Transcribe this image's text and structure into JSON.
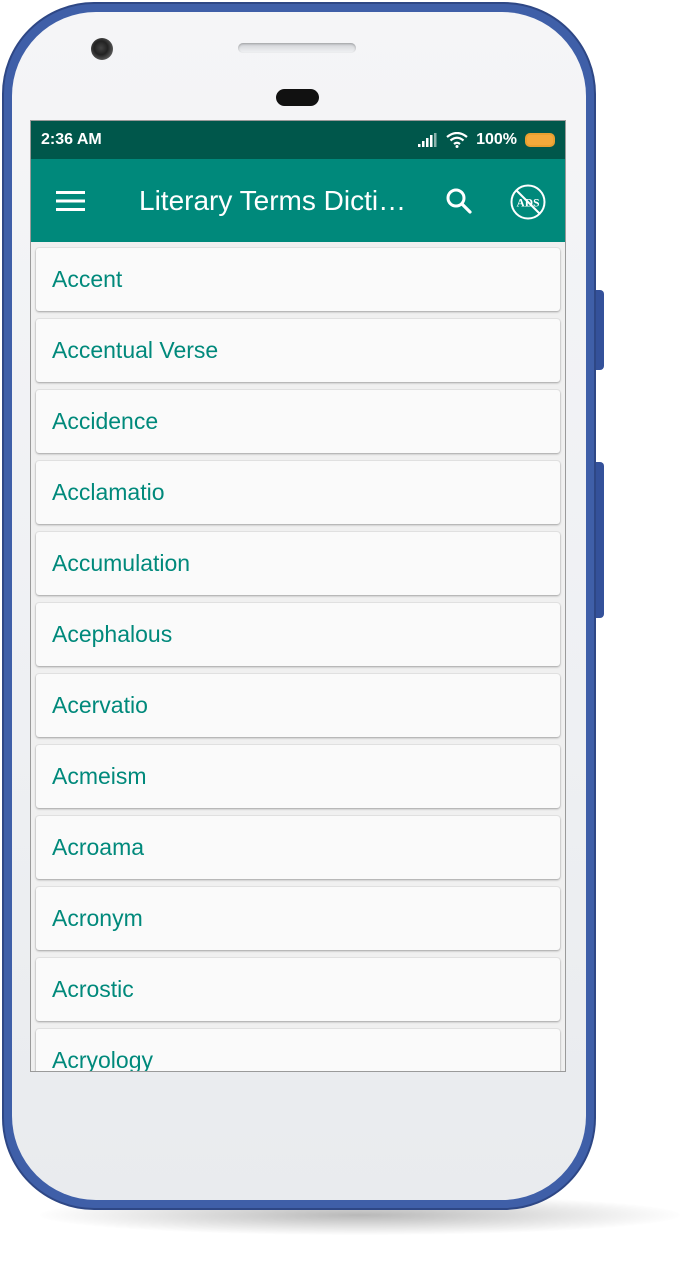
{
  "status_bar": {
    "time": "2:36 AM",
    "battery": "100%"
  },
  "app_bar": {
    "title": "Literary Terms Dictionary",
    "menu_icon": "hamburger-menu-icon",
    "search_icon": "search-icon",
    "ads_icon": "no-ads-icon",
    "ads_label": "ADS"
  },
  "terms": [
    "Accent",
    "Accentual Verse",
    "Accidence",
    "Acclamatio",
    "Accumulation",
    "Acephalous",
    "Acervatio",
    "Acmeism",
    "Acroama",
    "Acronym",
    "Acrostic",
    "Acryology"
  ],
  "colors": {
    "status_bar": "#00574b",
    "app_bar": "#00897b",
    "term_text": "#00897b",
    "phone_frame": "#3f5fa8"
  }
}
